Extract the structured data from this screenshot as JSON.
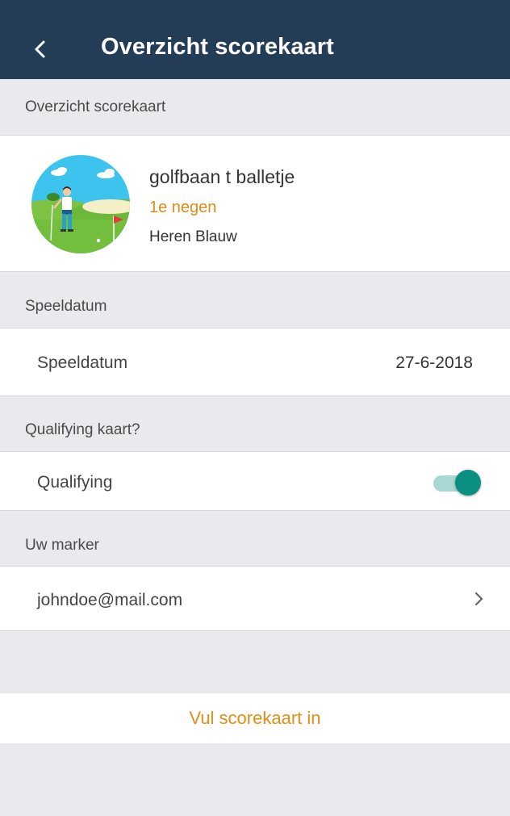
{
  "appbar": {
    "back_icon": "chevron-left-icon",
    "title": "Overzicht scorekaart"
  },
  "overview": {
    "header": "Overzicht scorekaart",
    "avatar_icon": "golfer-illustration",
    "course_name": "golfbaan t balletje",
    "subtitle": "1e negen",
    "tee": "Heren Blauw"
  },
  "play_date": {
    "header": "Speeldatum",
    "label": "Speeldatum",
    "value": "27-6-2018"
  },
  "qualifying": {
    "header": "Qualifying kaart?",
    "label": "Qualifying",
    "enabled": true
  },
  "marker": {
    "header": "Uw marker",
    "email": "johndoe@mail.com",
    "chevron_icon": "chevron-right-icon"
  },
  "action": {
    "label": "Vul scorekaart in"
  },
  "colors": {
    "appbar": "#233d56",
    "accent": "#e08e14",
    "toggle_on": "#0b8f80",
    "background": "#e9e9ee"
  }
}
